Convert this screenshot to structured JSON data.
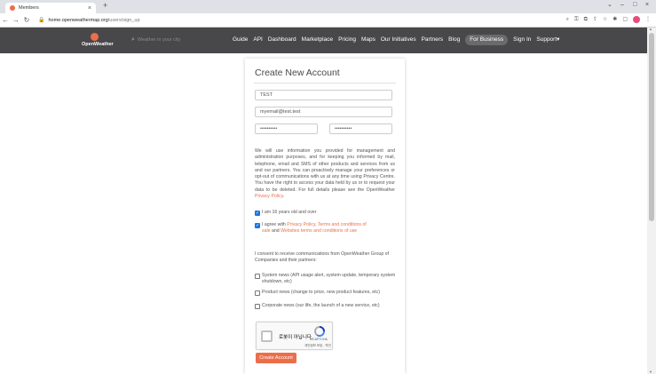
{
  "browser": {
    "tab_title": "Members",
    "tab_close": "×",
    "new_tab": "+",
    "url_host": "home.openweathermap.org",
    "url_path": "/users/sign_up",
    "window_controls": [
      "⌄",
      "–",
      "□",
      "×"
    ]
  },
  "nav": {
    "logo_text": "OpenWeather",
    "search_placeholder": "Weather in your city",
    "links": [
      "Guide",
      "API",
      "Dashboard",
      "Marketplace",
      "Pricing",
      "Maps",
      "Our Initiatives",
      "Partners",
      "Blog",
      "For Business",
      "Sign In",
      "Support▾"
    ]
  },
  "form": {
    "title": "Create New Account",
    "username_value": "TEST",
    "email_value": "myemail@test.test",
    "password_value": "••••••••••",
    "password_confirm_value": "••••••••••",
    "policy_text": "We will use information you provided for management and administration purposes, and for keeping you informed by mail, telephone, email and SMS of other products and services from us and our partners. You can proactively manage your preferences or opt-out of communications with us at any time using Privacy Centre. You have the right to access your data held by us or to request your data to be deleted. For full details please see the OpenWeather ",
    "policy_link": "Privacy Policy",
    "age_label": "I am 16 years old and over",
    "agree_prefix": "I agree with ",
    "agree_link1": "Privacy Policy, Terms and conditions of sale",
    "agree_and": " and ",
    "agree_link2": "Websites terms and conditions of use",
    "consent_text": "I consent to receive communications from OpenWeather Group of Companies and their partners:",
    "opt_system": "System news (API usage alert, system update, temporary system shutdown, etc)",
    "opt_product": "Product news (change to price, new product features, etc)",
    "opt_corporate": "Corporate news (our life, the launch of a new service, etc)",
    "captcha_label": "로봇이 아닙니다.",
    "captcha_brand": "reCAPTCHA",
    "captcha_privacy": "개인정보 보호 - 약관",
    "submit_label": "Create Account"
  },
  "colors": {
    "accent": "#eb6e4b",
    "nav_bg": "#48484a",
    "checkbox_checked": "#1a73e8"
  }
}
